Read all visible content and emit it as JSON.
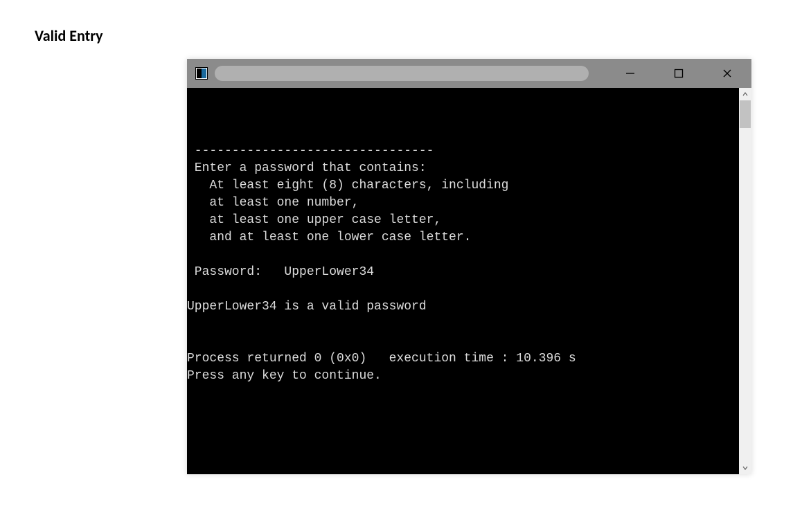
{
  "page": {
    "heading": "Valid Entry"
  },
  "console": {
    "lines": [
      "",
      " --------------------------------",
      " Enter a password that contains:",
      "   At least eight (8) characters, including",
      "   at least one number,",
      "   at least one upper case letter,",
      "   and at least one lower case letter.",
      "",
      " Password:   UpperLower34",
      "",
      "UpperLower34 is a valid password",
      "",
      "",
      "Process returned 0 (0x0)   execution time : 10.396 s",
      "Press any key to continue."
    ]
  }
}
